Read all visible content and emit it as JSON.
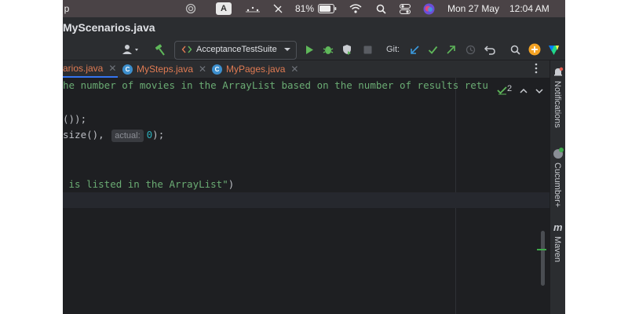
{
  "menubar": {
    "app_fragment": "p",
    "input_source": "A",
    "battery_percent": "81%",
    "date": "Mon 27 May",
    "time": "12:04 AM"
  },
  "window": {
    "title": "MyScenarios.java"
  },
  "toolbar": {
    "run_config": "AcceptanceTestSuite",
    "git_label": "Git:"
  },
  "tabs": [
    {
      "label": "arios.java",
      "active": true
    },
    {
      "label": "MySteps.java",
      "icon": "C"
    },
    {
      "label": "MyPages.java",
      "icon": "C"
    }
  ],
  "editor": {
    "line1": "he number of movies in the ArrayList based on the number of results retu",
    "line2": "());",
    "line3_before": "size(), ",
    "hint_label": "actual:",
    "line3_value": "0",
    "line3_after": ");",
    "line4_string": " is listed in the ArrayList\"",
    "line4_after": ")",
    "inspection_count": "2"
  },
  "right_sidebar": {
    "notifications": "Notifications",
    "cucumber": "Cucumber+",
    "maven_icon": "m",
    "maven": "Maven"
  },
  "colors": {
    "editor_bg": "#1e1f22",
    "chrome_bg": "#2b2d30",
    "run_green": "#5fb85a",
    "git_blue": "#3b9be0",
    "string_green": "#6aab73",
    "number_cyan": "#2aacb8",
    "tab_orange": "#e07b53",
    "update_orange": "#f4a324"
  }
}
